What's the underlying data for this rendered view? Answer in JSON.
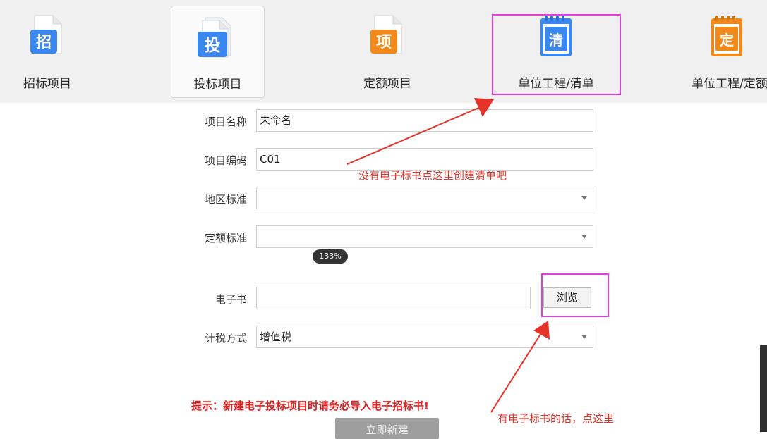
{
  "project_types": [
    {
      "label": "招标项目",
      "glyph": "招",
      "color": "#3a87f0"
    },
    {
      "label": "投标项目",
      "glyph": "投",
      "color": "#3a87f0"
    },
    {
      "label": "定额项目",
      "glyph": "项",
      "color": "#f28a1b"
    },
    {
      "label": "单位工程/清单",
      "glyph": "清",
      "color": "#3a87f0"
    },
    {
      "label": "单位工程/定额",
      "glyph": "定",
      "color": "#f28a1b"
    }
  ],
  "selected_type_index": 1,
  "form": {
    "name_label": "项目名称",
    "name_value": "未命名",
    "code_label": "项目编码",
    "code_value": "C01",
    "region_label": "地区标准",
    "region_value": "",
    "quota_label": "定额标准",
    "quota_value": "",
    "zoom": "133%",
    "ebook_label": "电子书",
    "ebook_value": "",
    "browse_label": "浏览",
    "tax_label": "计税方式",
    "tax_value": "增值税"
  },
  "tip": "提示：新建电子投标项目时请务必导入电子招标书!",
  "create_label": "立即新建",
  "annotations": {
    "top": "没有电子标书点这里创建清单吧",
    "bottom": "有电子标书的话，点这里"
  },
  "colors": {
    "icon_blue": "#3a87f0",
    "icon_orange": "#f28a1b",
    "highlight": "#e23ce5",
    "annotation_red": "#e5332a"
  }
}
